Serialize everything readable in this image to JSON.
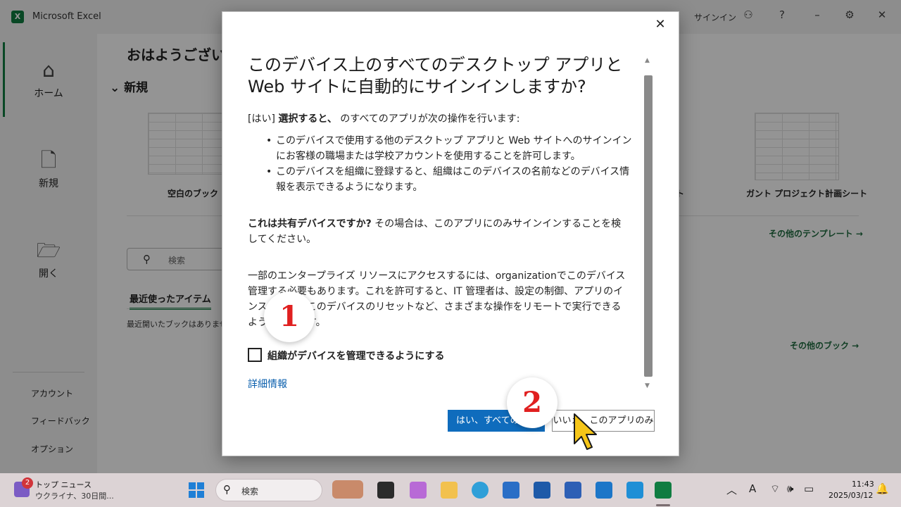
{
  "excel": {
    "app_title": "Microsoft Excel",
    "signin_label": "サインイン",
    "nav": {
      "home": "ホーム",
      "new": "新規",
      "open": "開く",
      "account": "アカウント",
      "feedback": "フィードバック",
      "options": "オプション"
    },
    "greeting": "おはようございま",
    "new_section": "新規",
    "templates": {
      "blank_workbook": "空白のブック",
      "gantt": "ガント プロジェクト計画シート",
      "partial_label": "ト",
      "more_templates": "その他のテンプレート →"
    },
    "search_placeholder": "検索",
    "recent_tab": "最近使ったアイテム",
    "recent_empty": "最近開いたブックはありません",
    "more_books": "その他のブック →"
  },
  "dialog": {
    "title_line1": "このデバイス上のすべてのデスクトップ アプリと",
    "title_line2": "Web サイトに自動的にサインインしますか?",
    "intro_prefix": "[はい]",
    "intro_bold": "選択すると、",
    "intro_rest": "のすべてのアプリが次の操作を行います:",
    "bullet1_line1": "このデバイスで使用する他のデスクトップ アプリと Web サイトへのサインイン",
    "bullet1_line2": "にお客様の職場または学校アカウントを使用することを許可します。",
    "bullet2_line1": "このデバイスを組織に登録すると、組織はこのデバイスの名前などのデバイス情",
    "bullet2_line2": "報を表示できるようになります。",
    "shared_bold": "これは共有デバイスですか?",
    "shared_rest_line1": "その場合は、このアプリにのみサインインすることを検",
    "shared_rest_line2": "してください。",
    "enterprise_line1": "一部のエンタープライズ リソースにアクセスするには、organizationでこのデバイス",
    "enterprise_line2": "管理する必要もあります。これを許可すると、IT 管理者は、設定の制御、アプリのイ",
    "enterprise_line3": "ンストール、このデバイスのリセットなど、さまざまな操作をリモートで実行できる",
    "enterprise_line4": "ようになります。",
    "checkbox_label": "組織がデバイスを管理できるようにする",
    "checkbox_checked": false,
    "more_info": "詳細情報",
    "btn_yes": "はい、すべてのアプリ",
    "btn_no": "いいえ、このアプリのみ",
    "close_glyph": "✕"
  },
  "annotations": {
    "step1": "1",
    "step2": "2",
    "cursor_color": "#f5c518"
  },
  "taskbar": {
    "news_badge": "2",
    "news_title": "トップ ニュース",
    "news_sub": "ウクライナ、30日間...",
    "search_label": "検索",
    "time": "11:43",
    "date": "2025/03/12",
    "ime": "A"
  },
  "colors": {
    "excel_green": "#107c41",
    "primary_blue": "#0f6cbd",
    "link_blue": "#0a5fad",
    "annotation_red": "#e02020"
  }
}
